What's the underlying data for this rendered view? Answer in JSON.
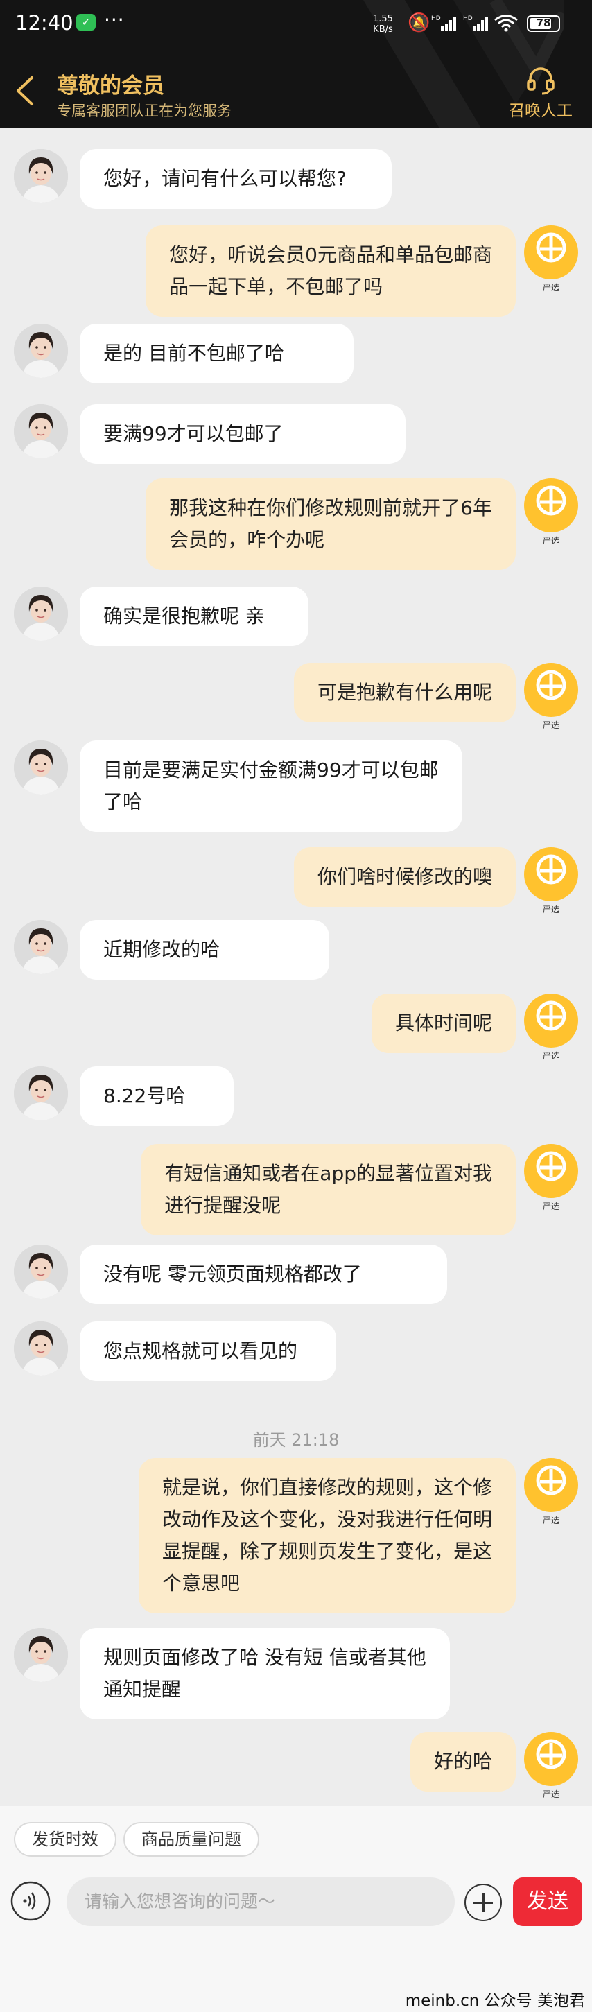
{
  "status_bar": {
    "time": "12:40",
    "app_icon": "wechat-icon",
    "more": "···",
    "net_speed_value": "1.55",
    "net_speed_unit": "KB/s",
    "signal_label_1": "HD",
    "signal_label_2": "HD",
    "battery": "78"
  },
  "header": {
    "title": "尊敬的会员",
    "subtitle": "专属客服团队正在为您服务",
    "call_button": "召唤人工",
    "accent_color": "#f0c060"
  },
  "self_avatar_label": "严选",
  "messages": [
    {
      "side": "in",
      "lines": [
        "您好，请问有什么可以帮您?"
      ]
    },
    {
      "side": "out",
      "lines": [
        "您好，听说会员0元商品和单品包邮商",
        "品一起下单，不包邮了吗"
      ]
    },
    {
      "side": "in",
      "lines": [
        "是的 目前不包邮了哈"
      ]
    },
    {
      "side": "in",
      "lines": [
        "要满99才可以包邮了"
      ]
    },
    {
      "side": "out",
      "lines": [
        "那我这种在你们修改规则前就开了6年",
        "会员的，咋个办呢"
      ]
    },
    {
      "side": "in",
      "lines": [
        "确实是很抱歉呢 亲"
      ]
    },
    {
      "side": "out",
      "lines": [
        "可是抱歉有什么用呢"
      ]
    },
    {
      "side": "in",
      "lines": [
        "目前是要满足实付金额满99才可以包邮",
        "了哈"
      ]
    },
    {
      "side": "out",
      "lines": [
        "你们啥时候修改的噢"
      ]
    },
    {
      "side": "in",
      "lines": [
        "近期修改的哈"
      ]
    },
    {
      "side": "out",
      "lines": [
        "具体时间呢"
      ]
    },
    {
      "side": "in",
      "lines": [
        "8.22号哈"
      ]
    },
    {
      "side": "out",
      "lines": [
        "有短信通知或者在app的显著位置对我",
        "进行提醒没呢"
      ]
    },
    {
      "side": "in",
      "lines": [
        "没有呢 零元领页面规格都改了"
      ]
    },
    {
      "side": "in",
      "lines": [
        "您点规格就可以看见的"
      ]
    },
    {
      "side": "out",
      "lines": [
        "就是说，你们直接修改的规则，这个修",
        "改动作及这个变化，没对我进行任何明",
        "显提醒，除了规则页发生了变化，是这",
        "个意思吧"
      ]
    },
    {
      "side": "in",
      "lines": [
        "规则页面修改了哈 没有短 信或者其他",
        "通知提醒"
      ]
    },
    {
      "side": "out",
      "lines": [
        "好的哈"
      ]
    }
  ],
  "timestamp": "前天 21:18",
  "quick_replies": [
    "发货时效",
    "商品质量问题"
  ],
  "input": {
    "placeholder": "请输入您想咨询的问题～"
  },
  "send_button": "发送",
  "send_color": "#ee2a36",
  "watermark": "meinb.cn  公众号 美泡君"
}
